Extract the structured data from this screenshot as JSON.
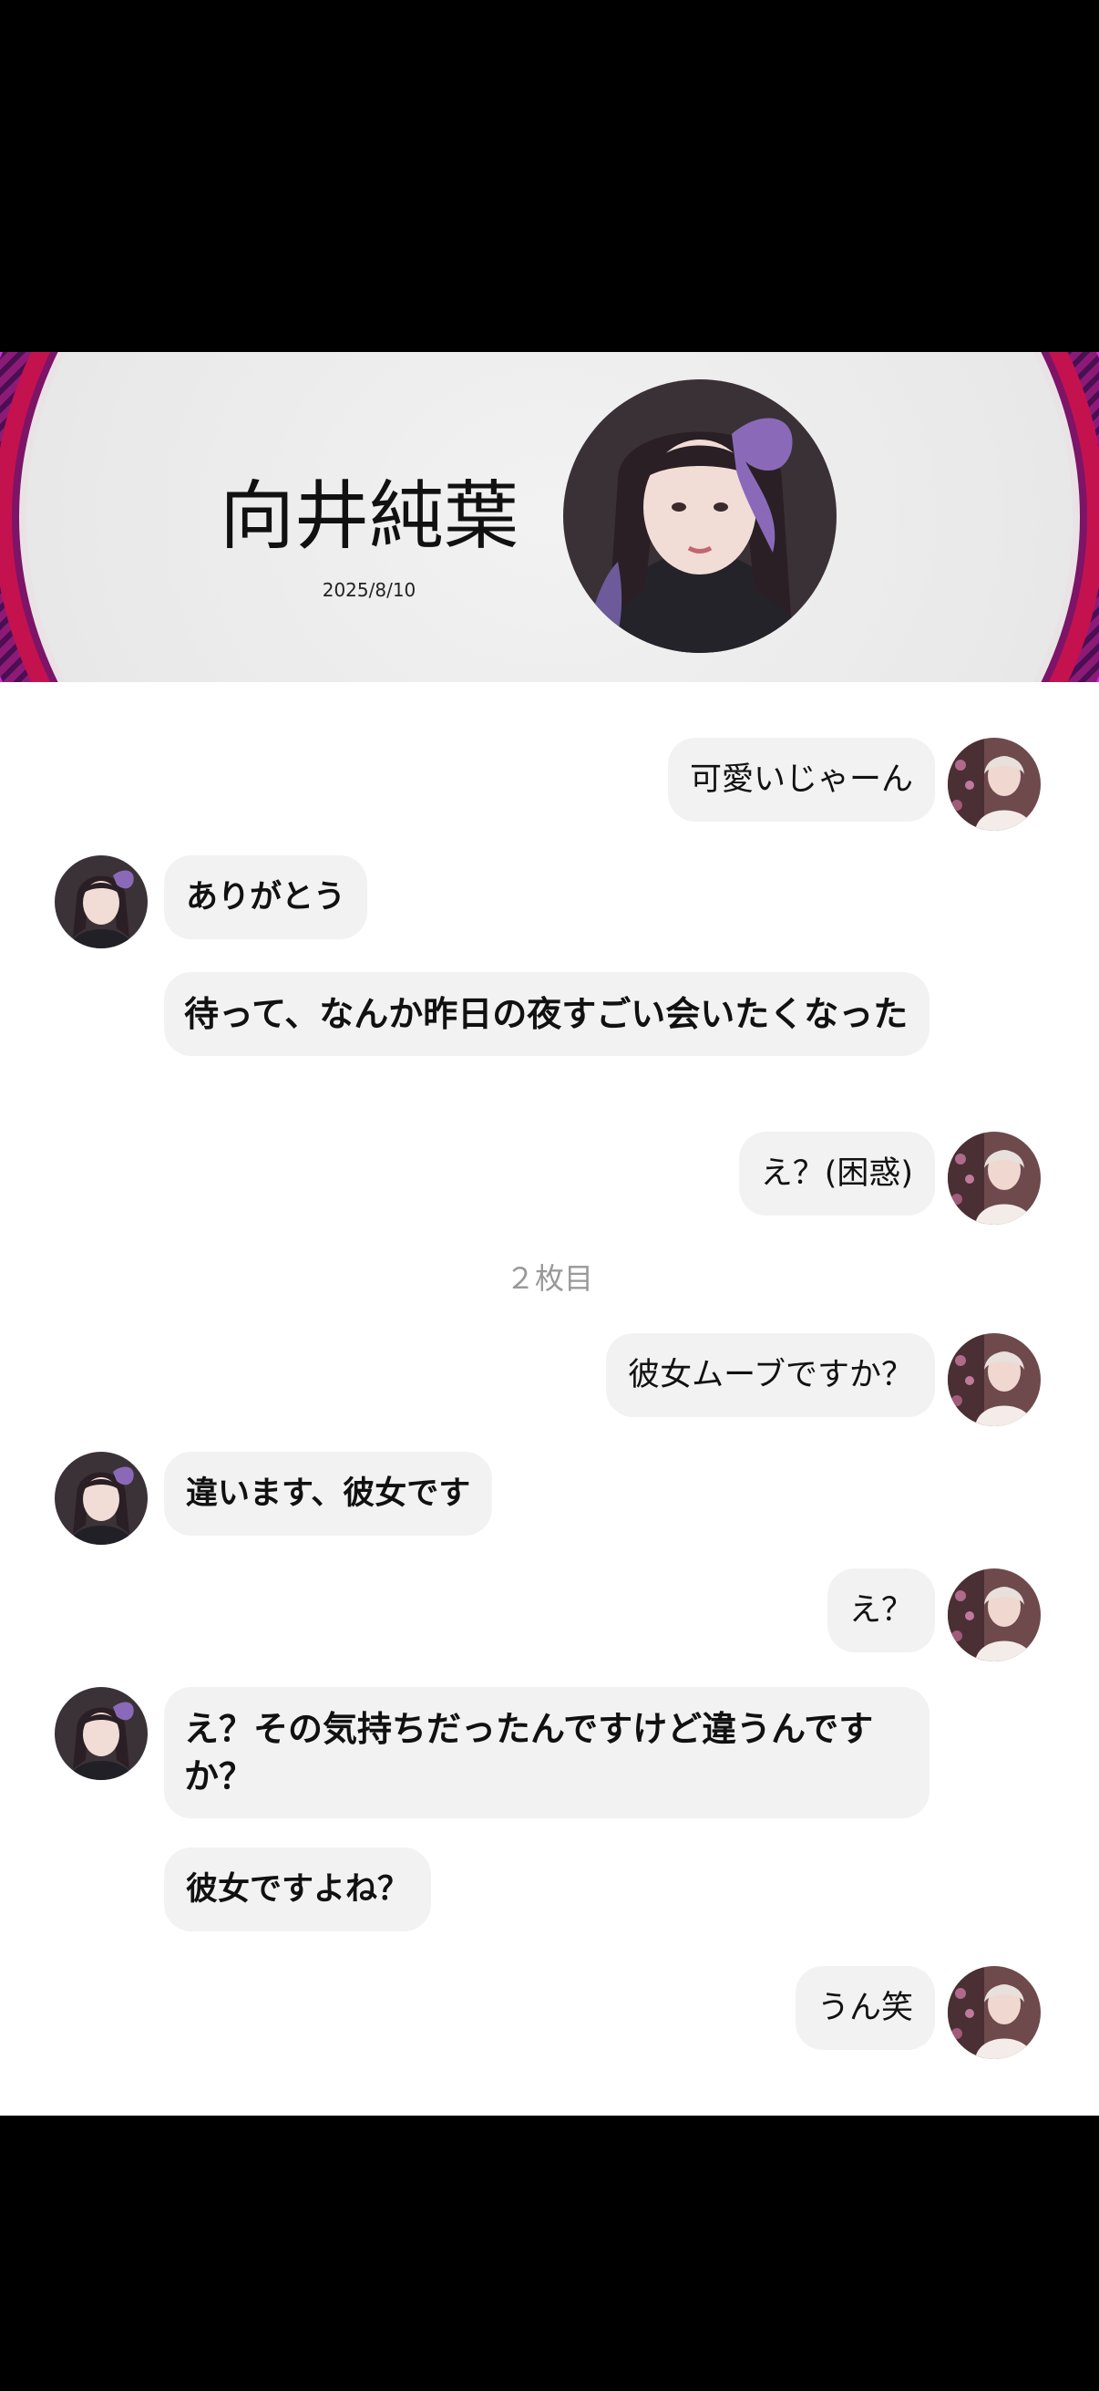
{
  "header": {
    "name": "向井純葉",
    "date": "2025/8/10",
    "avatar": "profile-photo"
  },
  "colors": {
    "banner_magenta": "#d92be0",
    "banner_crimson": "#c4124f",
    "banner_center": "#eeeeee",
    "bubble": "#f2f2f2",
    "divider_text": "#999999"
  },
  "messages": [
    {
      "side": "sent",
      "text": "可愛いじゃーん"
    },
    {
      "side": "received",
      "text": "ありがとう"
    },
    {
      "side": "received",
      "text": "待って、なんか昨日の夜すごい会いたくなった"
    },
    {
      "side": "sent",
      "text": "え？(困惑)"
    },
    {
      "side": "divider",
      "text": "２枚目"
    },
    {
      "side": "sent",
      "text": "彼女ムーブですか？"
    },
    {
      "side": "received",
      "text": "違います、彼女です"
    },
    {
      "side": "sent",
      "text": "え？"
    },
    {
      "side": "received",
      "text": "え？その気持ちだったんですけど違うんですか？"
    },
    {
      "side": "received",
      "text": "彼女ですよね？"
    },
    {
      "side": "sent",
      "text": "うん笑"
    }
  ]
}
